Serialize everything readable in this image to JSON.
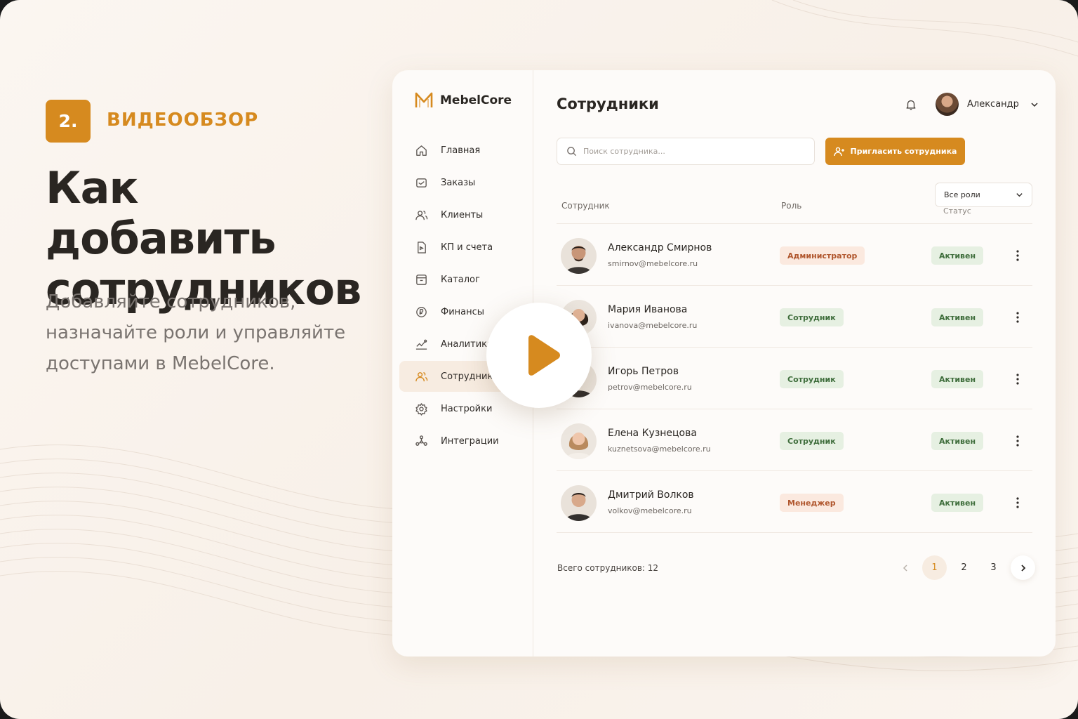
{
  "promo": {
    "badge": "2.",
    "kicker": "ВИДЕООБЗОР",
    "headline": "Как добавить сотрудников",
    "description": "Добавляйте сотрудников, назначайте роли и управляйте доступами в MebelCore."
  },
  "colors": {
    "accent": "#d68a1f",
    "active_bg": "#f7ece1",
    "status_green": "#3e6d3b"
  },
  "app": {
    "logo": "MebelCore",
    "nav": [
      {
        "label": "Главная",
        "icon": "home-icon"
      },
      {
        "label": "Заказы",
        "icon": "orders-icon"
      },
      {
        "label": "Клиенты",
        "icon": "clients-icon"
      },
      {
        "label": "КП и счета",
        "icon": "document-icon"
      },
      {
        "label": "Каталог",
        "icon": "catalog-icon"
      },
      {
        "label": "Финансы",
        "icon": "finance-icon"
      },
      {
        "label": "Аналитика",
        "icon": "analytics-icon"
      },
      {
        "label": "Сотрудники",
        "icon": "team-icon",
        "active": true
      },
      {
        "label": "Настройки",
        "icon": "settings-icon"
      },
      {
        "label": "Интеграции",
        "icon": "integrations-icon"
      }
    ],
    "header": {
      "title": "Сотрудники",
      "user_name": "Александр"
    },
    "search_placeholder": "Поиск сотрудника...",
    "invite_label": "Пригласить сотрудника",
    "role_filter": "Все роли",
    "columns": {
      "employee": "Сотрудник",
      "role": "Роль",
      "status": "Статус"
    },
    "employees": [
      {
        "name": "Александр Смирнов",
        "email": "smirnov@mebelcore.ru",
        "role": "Администратор",
        "status": "Активен"
      },
      {
        "name": "Мария Иванова",
        "email": "ivanova@mebelcore.ru",
        "role": "Сотрудник",
        "status": "Активен"
      },
      {
        "name": "Игорь Петров",
        "email": "petrov@mebelcore.ru",
        "role": "Сотрудник",
        "status": "Активен"
      },
      {
        "name": "Елена Кузнецова",
        "email": "kuznetsova@mebelcore.ru",
        "role": "Сотрудник",
        "status": "Активен"
      },
      {
        "name": "Дмитрий Волков",
        "email": "volkov@mebelcore.ru",
        "role": "Менеджер",
        "status": "Активен"
      }
    ],
    "total": "Всего сотрудников: 12",
    "pages": [
      "1",
      "2",
      "3"
    ],
    "current_page": "1"
  }
}
